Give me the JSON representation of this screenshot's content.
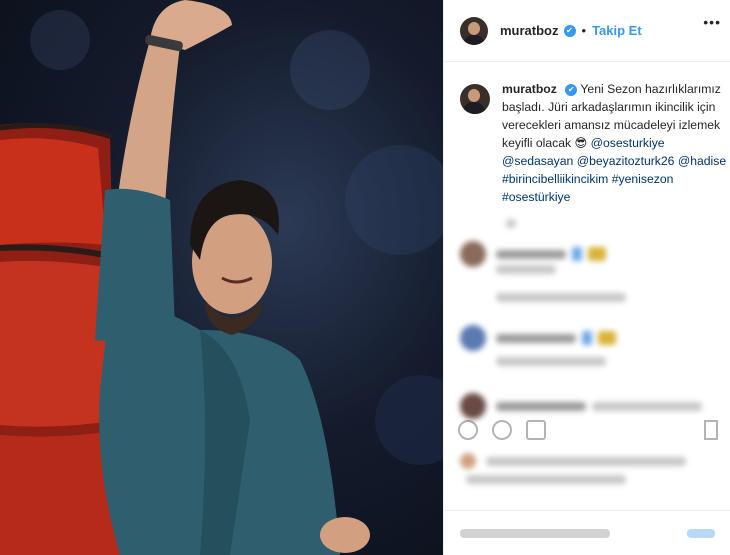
{
  "header": {
    "username": "muratboz",
    "verified_glyph": "✔",
    "separator": "•",
    "follow_label": "Takip Et",
    "more_glyph": "•••"
  },
  "caption": {
    "username": "muratboz",
    "text_1": "Yeni Sezon hazırlıklarımız başladı. Jüri arkadaşlarımın ikincilik için verecekleri amansız mücadeleyi izlemek keyifli olacak 😎",
    "mention_1": "@osesturkiye",
    "mention_2": "@sedasayan",
    "mention_3": "@beyazitozturk26",
    "mention_4": "@hadise",
    "hashtag_1": "#birincibelliikincikim",
    "hashtag_2": "#yenisezon",
    "hashtag_3": "#osestürkiye"
  },
  "icons": {
    "verified": "verified-badge-icon",
    "more": "more-options-icon",
    "like": "heart-icon",
    "comment": "comment-icon",
    "share": "share-icon",
    "save": "bookmark-icon"
  },
  "colors": {
    "link_blue": "#3897f0",
    "mention_blue": "#003569",
    "chair_red": "#c8301c",
    "shirt_teal": "#2f5f6e"
  }
}
